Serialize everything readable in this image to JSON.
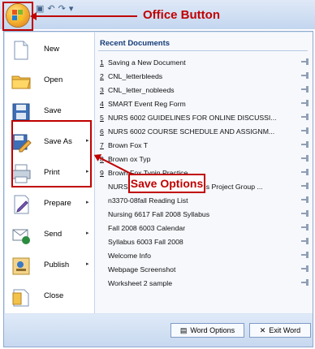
{
  "annotations": {
    "office_button": "Office Button",
    "save_options": "Save Options"
  },
  "commands": [
    {
      "label": "New",
      "icon": "new-document-icon"
    },
    {
      "label": "Open",
      "icon": "open-folder-icon"
    },
    {
      "label": "Save",
      "icon": "save-icon"
    },
    {
      "label": "Save As",
      "icon": "save-as-icon",
      "submenu": "▸"
    },
    {
      "label": "Print",
      "icon": "printer-icon",
      "submenu": "▸"
    },
    {
      "label": "Prepare",
      "icon": "prepare-icon",
      "submenu": "▸"
    },
    {
      "label": "Send",
      "icon": "send-icon",
      "submenu": "▸"
    },
    {
      "label": "Publish",
      "icon": "publish-icon",
      "submenu": "▸"
    },
    {
      "label": "Close",
      "icon": "close-document-icon"
    }
  ],
  "recent": {
    "title": "Recent Documents",
    "items": [
      {
        "num": "1",
        "name": "Saving a New Document"
      },
      {
        "num": "2",
        "name": "CNL_letterbleeds"
      },
      {
        "num": "3",
        "name": "CNL_letter_nobleeds"
      },
      {
        "num": "4",
        "name": "SMART Event Reg Form"
      },
      {
        "num": "5",
        "name": "NURS 6002 GUIDELINES FOR ONLINE DISCUSSI..."
      },
      {
        "num": "6",
        "name": "NURS 6002 COURSE SCHEDULE AND ASSIGNM..."
      },
      {
        "num": "7",
        "name": "Brown Fox T"
      },
      {
        "num": "8",
        "name": "Brown ox Typ"
      },
      {
        "num": "9",
        "name": "Brown Fox Typin Practice"
      },
      {
        "num": "",
        "name": "NURS 6903 Curriculum Analysis Project Group ..."
      },
      {
        "num": "",
        "name": "n3370-08fall Reading List"
      },
      {
        "num": "",
        "name": "Nursing 6617 Fall 2008 Syllabus"
      },
      {
        "num": "",
        "name": "Fall 2008 6003 Calendar"
      },
      {
        "num": "",
        "name": "Syllabus 6003 Fall 2008"
      },
      {
        "num": "",
        "name": "Welcome Info"
      },
      {
        "num": "",
        "name": "Webpage Screenshot"
      },
      {
        "num": "",
        "name": "Worksheet 2 sample"
      }
    ]
  },
  "footer": {
    "word_options": "Word Options",
    "exit_word": "Exit Word"
  },
  "colors": {
    "annotation_red": "#c00000",
    "menu_bg": "#d7e4f4",
    "title_blue": "#153b78"
  }
}
